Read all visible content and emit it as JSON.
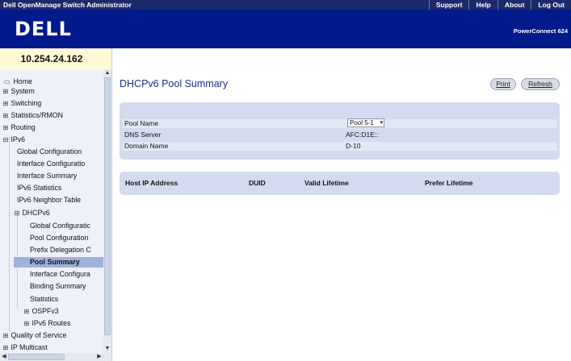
{
  "app_title": "Dell OpenManage Switch Administrator",
  "top_nav": [
    "Support",
    "Help",
    "About",
    "Log Out"
  ],
  "logo_text": "DELL",
  "product_name": "PowerConnect 624",
  "ip_address": "10.254.24.162",
  "tree": [
    {
      "label": "Home",
      "icon": "home-icon"
    },
    {
      "label": "System",
      "icon": "expand-plus-icon"
    },
    {
      "label": "Switching",
      "icon": "expand-plus-icon"
    },
    {
      "label": "Statistics/RMON",
      "icon": "expand-plus-icon"
    },
    {
      "label": "Routing",
      "icon": "expand-plus-icon"
    },
    {
      "label": "IPv6",
      "icon": "collapse-minus-icon"
    },
    {
      "label": "Global Configuration"
    },
    {
      "label": "Interface Configuratio"
    },
    {
      "label": "Interface Summary"
    },
    {
      "label": "IPv6 Statistics"
    },
    {
      "label": "IPv6 Neighbor Table"
    },
    {
      "label": "DHCPv6",
      "icon": "collapse-minus-icon"
    },
    {
      "label": "Global Configuratic"
    },
    {
      "label": "Pool Configuration"
    },
    {
      "label": "Prefix Delegation C"
    },
    {
      "label": "Pool Summary",
      "selected": true
    },
    {
      "label": "Interface Configura"
    },
    {
      "label": "Binding Summary"
    },
    {
      "label": "Statistics"
    },
    {
      "label": "OSPFv3",
      "icon": "expand-plus-icon"
    },
    {
      "label": "IPv6 Routes",
      "icon": "expand-plus-icon"
    },
    {
      "label": "Quality of Service",
      "icon": "expand-plus-icon"
    },
    {
      "label": "IP Multicast",
      "icon": "expand-plus-icon"
    }
  ],
  "page_title": "DHCPv6 Pool Summary",
  "buttons": {
    "print": "Print",
    "refresh": "Refresh"
  },
  "pool": {
    "pool_name_label": "Pool Name",
    "pool_name_value": "Pool 5-1",
    "dns_server_label": "DNS Server",
    "dns_server_value": "AFC:D1E::",
    "domain_name_label": "Domain Name",
    "domain_name_value": "D-10"
  },
  "table": {
    "columns": [
      "Host IP Address",
      "DUID",
      "Valid Lifetime",
      "Prefer Lifetime"
    ],
    "rows": []
  },
  "colors": {
    "header_bg": "#001a8c",
    "topbar_bg": "#1b2a6b",
    "title": "#1a2f8c",
    "panel": "#d4dbee",
    "selected": "#9fb1dd"
  }
}
